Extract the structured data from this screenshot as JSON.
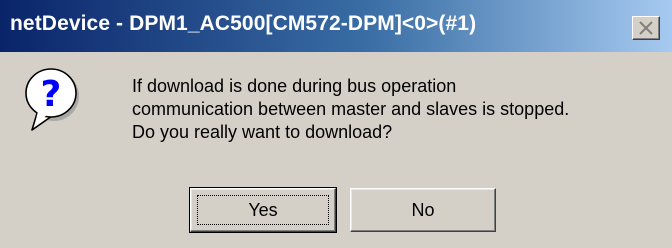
{
  "window": {
    "title": "netDevice - DPM1_AC500[CM572-DPM]<0>(#1)"
  },
  "dialog": {
    "icon": "question-icon",
    "message_lines": [
      "If download is done during bus operation",
      "communication between master and slaves is stopped.",
      "Do you really want to download?"
    ]
  },
  "buttons": {
    "yes_label": "Yes",
    "no_label": "No",
    "default": "yes"
  },
  "colors": {
    "titlebar_start": "#0a246a",
    "titlebar_end": "#a6caf0",
    "face": "#d4d0c8",
    "icon_blue": "#0000ff"
  }
}
